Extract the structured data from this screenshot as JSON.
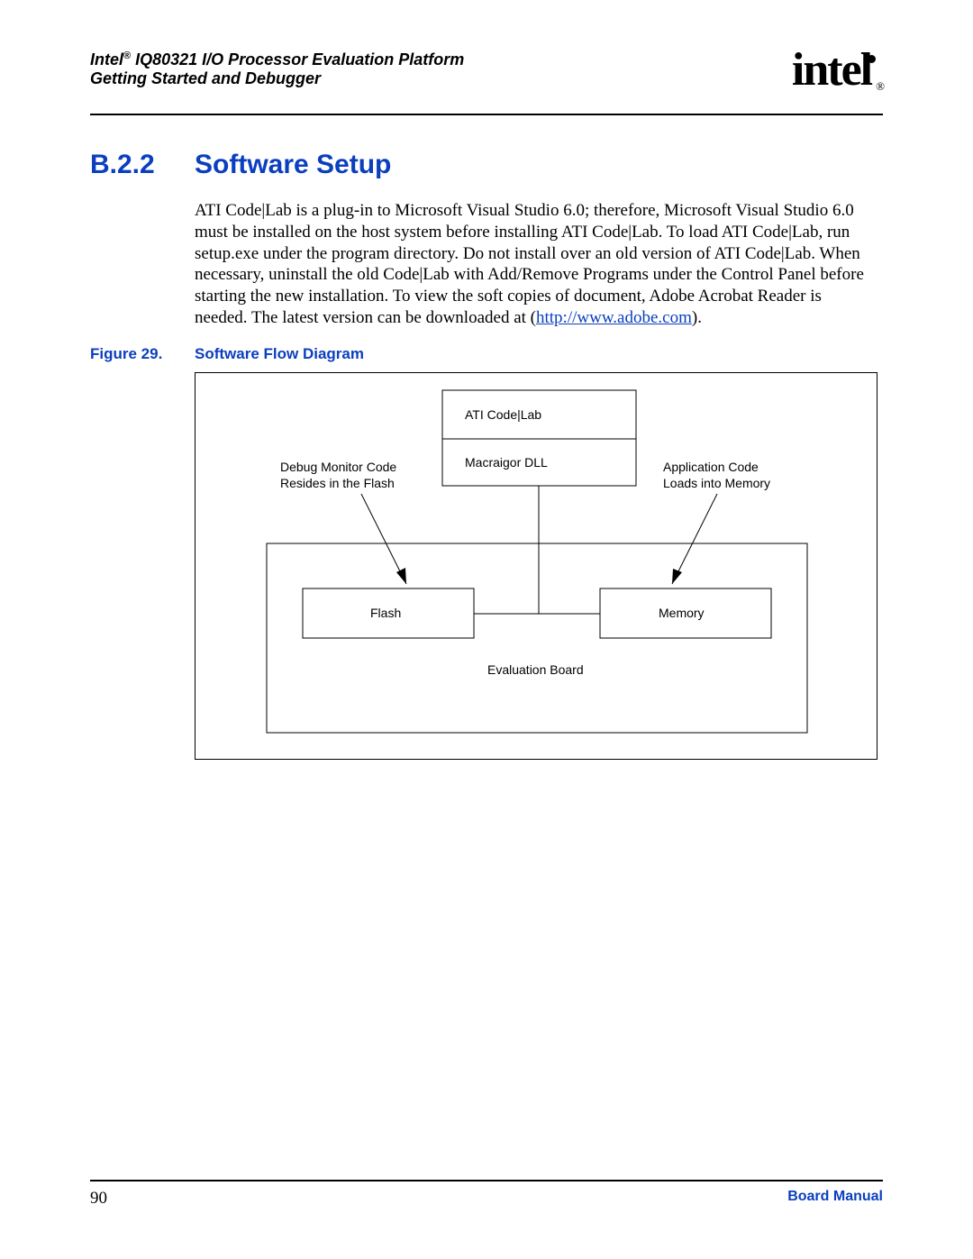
{
  "header": {
    "line1_prefix": "Intel",
    "line1_reg": "®",
    "line1_rest": " IQ80321 I/O Processor Evaluation Platform",
    "line2": "Getting Started and Debugger",
    "logo_text": "intel",
    "logo_reg": "®"
  },
  "section": {
    "number": "B.2.2",
    "title": "Software Setup"
  },
  "paragraph": {
    "text_before_link": "ATI Code|Lab is a plug-in to Microsoft Visual Studio 6.0; therefore, Microsoft Visual Studio 6.0 must be installed on the host system before installing ATI Code|Lab. To load ATI Code|Lab, run setup.exe under the program directory. Do not install over an old version of ATI Code|Lab. When necessary, uninstall the old Code|Lab with Add/Remove Programs under the Control Panel before starting the new installation. To view the soft copies of document, Adobe Acrobat Reader is needed. The latest version can be downloaded at (",
    "link_text": "http://www.adobe.com",
    "text_after_link": ")."
  },
  "figure": {
    "label": "Figure 29.",
    "title": "Software Flow Diagram"
  },
  "diagram": {
    "top_box_line1": "ATI Code|Lab",
    "top_box_line2": "Macraigor DLL",
    "left_note_line1": "Debug Monitor Code",
    "left_note_line2": "Resides in the Flash",
    "right_note_line1": "Application Code",
    "right_note_line2": "Loads into Memory",
    "flash_label": "Flash",
    "memory_label": "Memory",
    "board_label": "Evaluation Board"
  },
  "footer": {
    "page_number": "90",
    "manual": "Board Manual"
  }
}
